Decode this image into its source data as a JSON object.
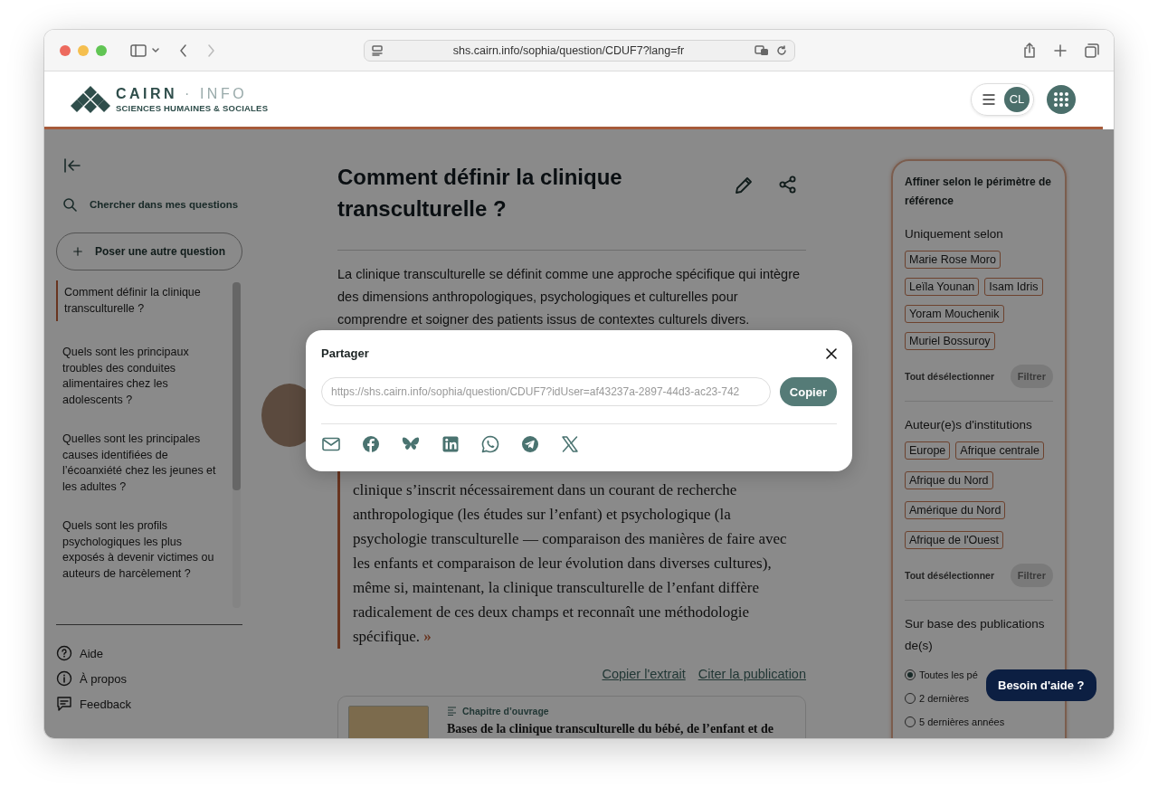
{
  "browser": {
    "url": "shs.cairn.info/sophia/question/CDUF7?lang=fr"
  },
  "header": {
    "logo_primary": "CAIRN",
    "logo_secondary": "· INFO",
    "logo_tagline": "SCIENCES HUMAINES & SOCIALES",
    "avatar_initials": "CL"
  },
  "sidebar": {
    "search_label": "Chercher dans mes questions",
    "new_question": "Poser une autre question",
    "questions": [
      {
        "text": "Comment définir la clinique transculturelle ?",
        "selected": true
      },
      {
        "text": "Quels sont les principaux troubles des conduites alimentaires chez les adolescents ?",
        "selected": false
      },
      {
        "text": "Quelles sont les principales causes identifiées de l’écoanxiété chez les jeunes et les adultes ?",
        "selected": false
      },
      {
        "text": "Quels sont les profils psychologiques les plus exposés à devenir victimes ou auteurs de harcèlement ?",
        "selected": false
      }
    ],
    "footer_links": [
      {
        "kind": "help",
        "label": "Aide"
      },
      {
        "kind": "info",
        "label": "À propos"
      },
      {
        "kind": "feedback",
        "label": "Feedback"
      }
    ]
  },
  "article": {
    "title": "Comment définir la clinique transculturelle ?",
    "summary": "La clinique transculturelle se définit comme une approche spécifique qui intègre des dimensions anthropologiques, psychologiques et culturelles pour comprendre et soigner des patients issus de contextes culturels divers.",
    "quote": "clinique s’inscrit nécessairement dans un courant de recherche anthropologique (les études sur l’enfant) et psychologique (la psychologie transculturelle — comparaison des manières de faire avec les enfants et comparaison de leur évolution dans diverses cultures), même si, maintenant, la clinique transculturelle de l’enfant diffère radicalement de ces deux champs et reconnaît une méthodologie spécifique.",
    "quote_close": "»",
    "actions": [
      "Copier l'extrait",
      "Citer la publication"
    ],
    "result": {
      "type": "Chapitre d’ouvrage",
      "title": "Bases de la clinique transculturelle du bébé, de l’enfant et de"
    }
  },
  "filters": {
    "title": "Affiner selon le périmètre de référence",
    "groups": [
      {
        "kind": "tags",
        "heading": "Uniquement selon",
        "tags": [
          {
            "label": "Marie Rose Moro",
            "selected": false
          },
          {
            "label": "Leïla Younan",
            "selected": false
          },
          {
            "label": "Isam Idris",
            "selected": false
          },
          {
            "label": "Yoram Mouchenik",
            "selected": false
          },
          {
            "label": "Muriel Bossuroy",
            "selected": false
          }
        ],
        "deselect": "Tout désélectionner",
        "apply": {
          "label": "Filtrer",
          "disabled": true
        }
      },
      {
        "kind": "tags",
        "heading": "Auteur(e)s d'institutions",
        "tags": [
          {
            "label": "Europe",
            "selected": false
          },
          {
            "label": "Afrique centrale",
            "selected": false
          },
          {
            "label": "Afrique du Nord",
            "selected": false
          },
          {
            "label": "Amérique du Nord",
            "selected": false
          },
          {
            "label": "Afrique de l'Ouest",
            "selected": false
          }
        ],
        "deselect": "Tout désélectionner",
        "apply": {
          "label": "Filtrer",
          "disabled": true
        }
      },
      {
        "kind": "radios",
        "heading": "Sur base des publications de(s)",
        "options": [
          {
            "label": "Toutes les pé",
            "selected": true
          },
          {
            "label": "2 dernières",
            "selected": false
          },
          {
            "label": "5 dernières années",
            "selected": false
          }
        ]
      }
    ]
  },
  "help_button": "Besoin d'aide ?",
  "share_dialog": {
    "title": "Partager",
    "url": "https://shs.cairn.info/sophia/question/CDUF7?idUser=af43237a-2897-44d3-ac23-742",
    "copy": "Copier",
    "networks": [
      {
        "kind": "email"
      },
      {
        "kind": "facebook"
      },
      {
        "kind": "bluesky"
      },
      {
        "kind": "linkedin"
      },
      {
        "kind": "whatsapp"
      },
      {
        "kind": "telegram"
      },
      {
        "kind": "x"
      }
    ]
  }
}
